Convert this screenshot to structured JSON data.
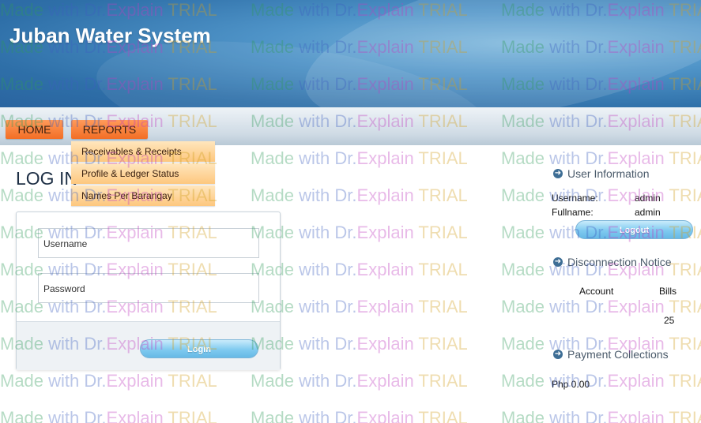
{
  "app": {
    "title": "Juban Water System"
  },
  "nav": {
    "home_label": "HOME",
    "reports_label": "REPORTS",
    "reports_menu": [
      "Receivables & Receipts",
      "Profile & Ledger Status",
      "Names Per Barangay"
    ]
  },
  "login": {
    "page_title": "LOG IN",
    "username_label": "Username",
    "password_label": "Password",
    "login_button": "Login"
  },
  "user_info": {
    "heading": "User Information",
    "username_label": "Username:",
    "username_value": "admin",
    "fullname_label": "Fullname:",
    "fullname_value": "admin",
    "logout_button": "Logout"
  },
  "disconnection": {
    "heading": "Disconnection Notice",
    "col_account": "Account",
    "col_bills": "Bills",
    "bills_value": "25"
  },
  "payments": {
    "heading": "Payment Collections",
    "amount": "Php 0.00"
  },
  "watermark": {
    "made": "Made",
    "with": "with",
    "dr": "Dr.",
    "explain": "Explain",
    "trial": "TRIAL"
  },
  "colors": {
    "header_blue": "#2e6fa8",
    "nav_orange": "#f26e25",
    "menu_peach": "#fdc77e",
    "button_blue": "#7fcaf0"
  }
}
